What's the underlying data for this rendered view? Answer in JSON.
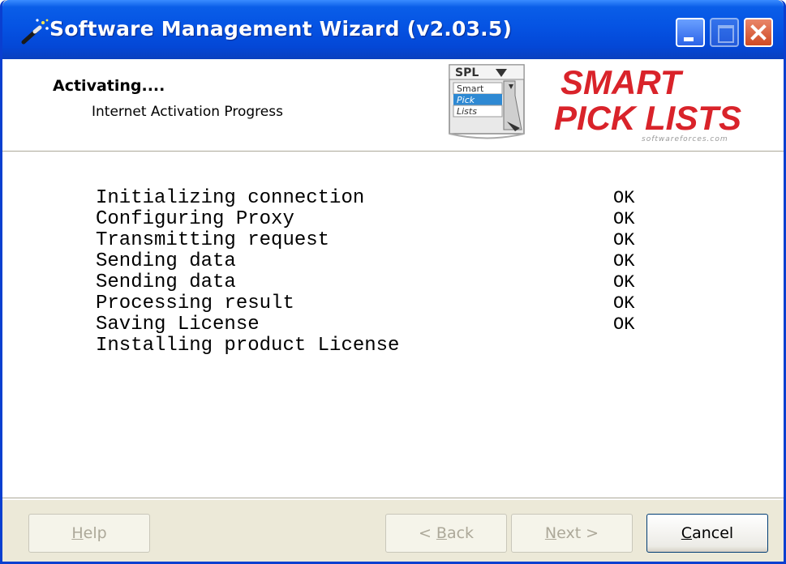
{
  "window": {
    "title": "Software Management Wizard (v2.03.5)"
  },
  "header": {
    "title": "Activating....",
    "subtitle": "Internet Activation Progress",
    "logo": {
      "badge": "SPL",
      "list_items": [
        "Smart",
        "Pick",
        "Lists"
      ],
      "brand_line1": "SMART",
      "brand_line2": "PICK LISTS",
      "website": "softwareforces.com"
    }
  },
  "log": [
    {
      "step": "Initializing connection",
      "status": "OK"
    },
    {
      "step": "Configuring Proxy",
      "status": "OK"
    },
    {
      "step": "Transmitting request",
      "status": "OK"
    },
    {
      "step": "Sending data",
      "status": "OK"
    },
    {
      "step": "Sending data",
      "status": "OK"
    },
    {
      "step": "Processing result",
      "status": "OK"
    },
    {
      "step": "Saving License",
      "status": "OK"
    },
    {
      "step": "Installing product License",
      "status": ""
    }
  ],
  "buttons": {
    "help": {
      "mnemonic": "H",
      "rest": "elp"
    },
    "back": {
      "prefix": "< ",
      "mnemonic": "B",
      "rest": "ack"
    },
    "next": {
      "mnemonic": "N",
      "rest": "ext >"
    },
    "cancel": {
      "mnemonic": "C",
      "rest": "ancel"
    }
  },
  "colors": {
    "titlebar": "#0553e3",
    "brand_red": "#d9232a",
    "dialog_bg": "#ece9d8"
  },
  "icons": {
    "app": "wand-icon",
    "minimize": "minimize-icon",
    "maximize": "maximize-icon",
    "close": "close-icon"
  }
}
